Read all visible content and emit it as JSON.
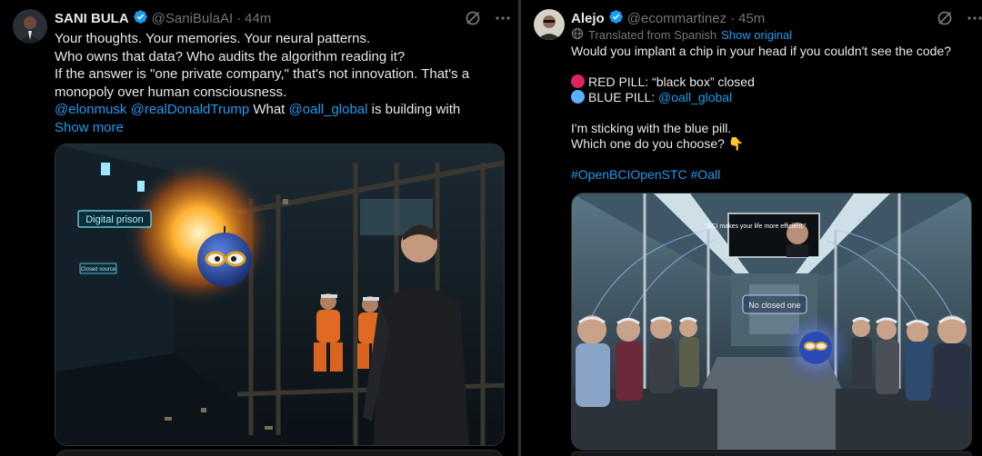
{
  "left_tweet": {
    "author_name": "SANI BULA",
    "handle": "@SaniBulaAI",
    "separator": "·",
    "time": "44m",
    "lines": [
      "Your thoughts. Your memories. Your neural patterns.",
      "Who owns that data? Who audits the algorithm reading it?",
      "If the answer is \"one private company,\" that's not innovation. That's a",
      "monopoly over human consciousness."
    ],
    "mention_1": "@elonmusk",
    "mention_2": "@realDonaldTrump",
    "text_mid": "What",
    "mention_3": "@oall_global",
    "text_end": "is building with",
    "show_more": "Show more",
    "image": {
      "sign_1": "Digital prison",
      "sign_2": "Closed source"
    }
  },
  "right_tweet": {
    "author_name": "Alejo",
    "handle": "@ecommartinez",
    "separator": "·",
    "time": "45m",
    "translated_label": "Translated from Spanish",
    "show_original": "Show original",
    "question": "Would you implant a chip in your head if you couldn't see the code?",
    "red_label": "RED PILL: “black box” closed",
    "blue_label_prefix": "BLUE PILL:",
    "blue_mention": "@oall_global",
    "line_sticking": "I'm sticking with the blue pill.",
    "line_which": "Which one do you choose?",
    "pointing_emoji": "👇",
    "hashtag_1": "#OpenBCIOpenSTC",
    "hashtag_2": "#Oall",
    "image": {
      "billboard_text": "“BCI makes your life more efficient.”",
      "hologram_text": "No closed one"
    }
  },
  "colors": {
    "background": "#000000",
    "text": "#e7e9ea",
    "muted": "#71767b",
    "link": "#1d9bf0",
    "verified": "#1d9bf0",
    "red_pill": "#e0245e",
    "blue_pill": "#5ab0ff"
  },
  "icons": [
    "verified-badge-icon",
    "grok-icon",
    "more-options-icon",
    "translate-icon"
  ]
}
